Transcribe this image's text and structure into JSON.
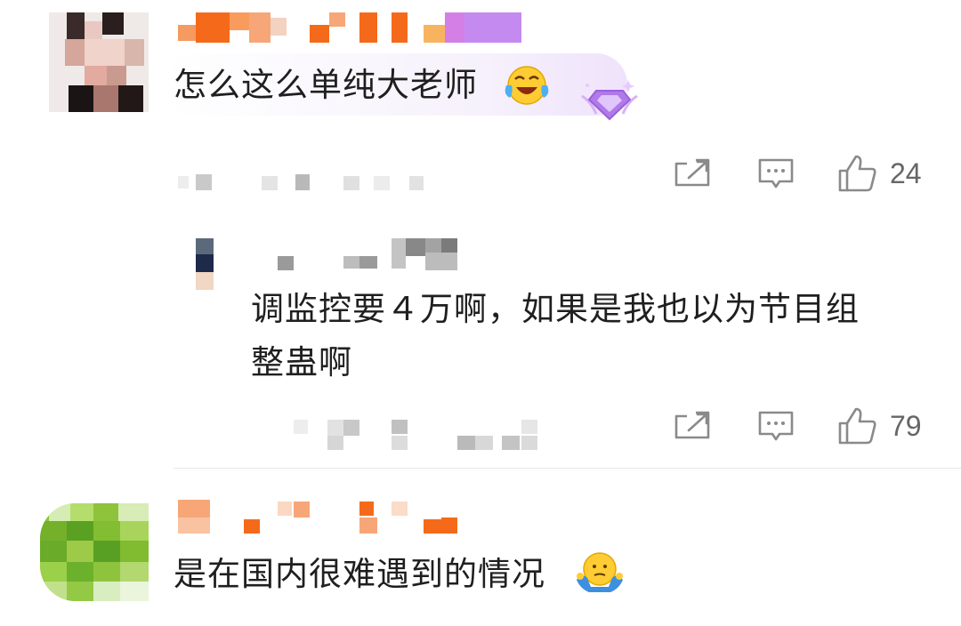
{
  "comments": [
    {
      "text": "怎么这么单纯大老师",
      "emoji": "crying-laughing-emoji",
      "badge": "diamond-badge-icon",
      "likes": "24",
      "replies": [
        {
          "text_line1": "调监控要４万啊，如果是我也以为节目组",
          "text_line2": "整蛊啊",
          "likes": "79"
        }
      ]
    },
    {
      "text": "是在国内很难遇到的情况",
      "emoji": "shrugging-emoji"
    }
  ],
  "icons": {
    "share": "share-icon",
    "comment": "comment-icon",
    "like": "thumbs-up-icon"
  },
  "colors": {
    "name_orange": "#f56a1a",
    "name_purple": "#c58af0",
    "icon_gray": "#888888"
  }
}
